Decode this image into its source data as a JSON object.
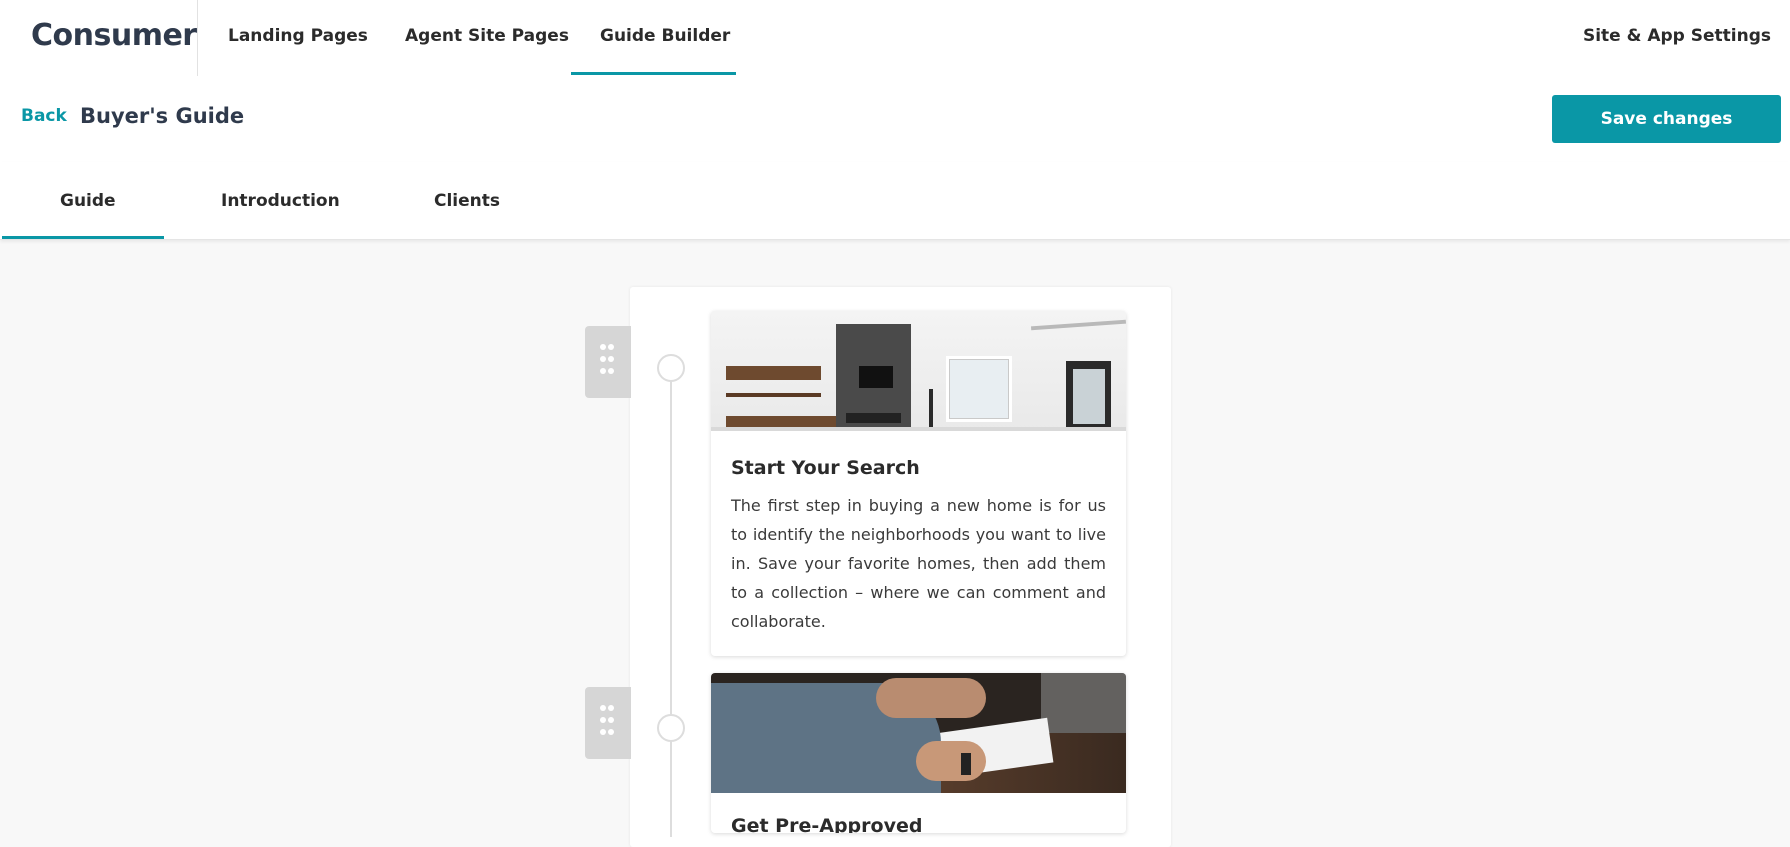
{
  "topnav": {
    "brand": "Consumer",
    "tabs": [
      {
        "label": "Landing Pages"
      },
      {
        "label": "Agent Site Pages"
      },
      {
        "label": "Guide Builder"
      }
    ],
    "active_tab": "Guide Builder",
    "settings_label": "Site & App Settings"
  },
  "subheader": {
    "back_label": "Back",
    "title": "Buyer's Guide",
    "save_label": "Save changes"
  },
  "subtabs": [
    {
      "label": "Guide"
    },
    {
      "label": "Introduction"
    },
    {
      "label": "Clients"
    }
  ],
  "active_subtab": "Guide",
  "steps": [
    {
      "title": "Start Your Search",
      "body": "The first step in buying a new home is for us to identify the neighborhoods you want to live in. Save your favorite homes, then add them to a collection – where we can comment and collaborate.",
      "image_icon": "living-room-photo"
    },
    {
      "title": "Get Pre-Approved",
      "body": "",
      "image_icon": "signing-documents-photo"
    }
  ],
  "colors": {
    "accent": "#0a97a6",
    "brand_text": "#2f3a4c",
    "background": "#f8f8f8"
  }
}
